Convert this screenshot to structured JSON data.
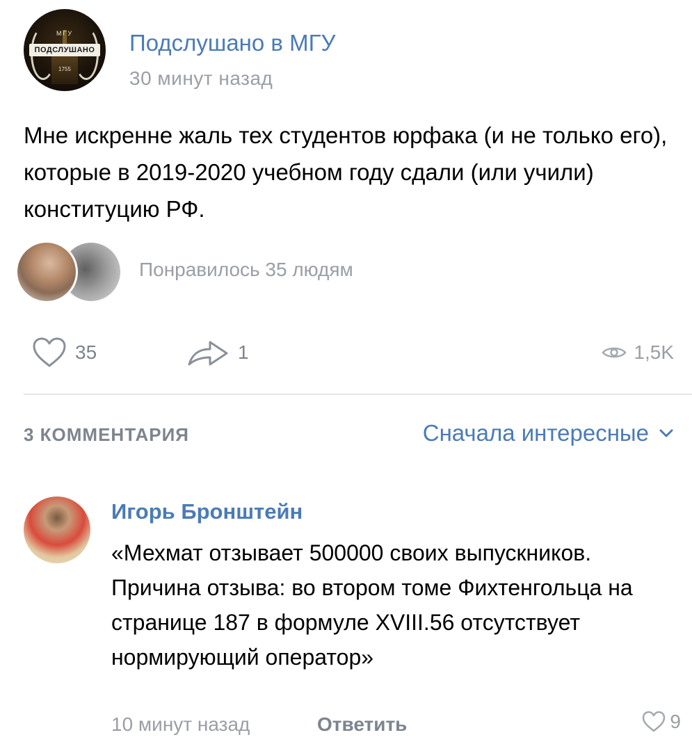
{
  "post": {
    "group_name": "Подслушано в МГУ",
    "time": "30 минут назад",
    "avatar": {
      "top_text": "МГУ",
      "banner_text": "ПОДСЛУШАНО",
      "year_text": "1755"
    },
    "text": "Мне искренне жаль тех студентов юрфака (и не только его), которые в 2019-2020 учебном году сдали (или учили) конституцию РФ.",
    "liked_by_text": "Понравилось 35 людям",
    "actions": {
      "likes": "35",
      "shares": "1",
      "views": "1,5K"
    }
  },
  "comments_header": {
    "count_label": "3 КОММЕНТАРИЯ",
    "sort_label": "Сначала интересные"
  },
  "comment": {
    "author": "Игорь Бронштейн",
    "text": "«Мехмат отзывает 500000 своих выпускников. Причина отзыва: во втором томе Фихтенгольца на странице 187 в формуле XVIII.56 отсутствует нормирующий оператор»",
    "time": "10 минут назад",
    "reply_label": "Ответить",
    "likes": "9"
  },
  "colors": {
    "link_blue": "#4a7bb7",
    "meta_gray": "#9a9ea5",
    "icon_gray": "#7d848d",
    "divider": "#e7e8ec"
  },
  "icons": {
    "like": "heart-outline-icon",
    "share": "share-arrow-icon",
    "views": "eye-icon",
    "sort": "chevron-down-icon"
  }
}
